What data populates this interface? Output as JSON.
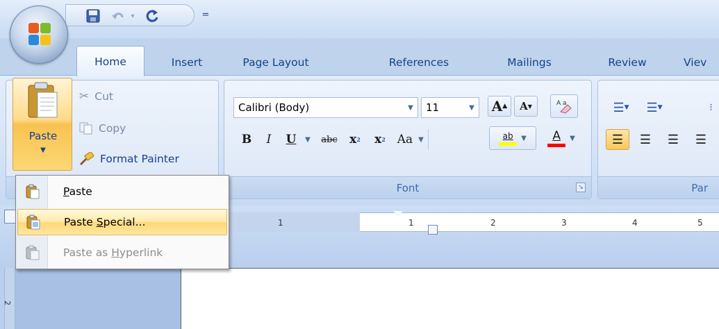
{
  "quick_access": {
    "save_icon": "save-icon",
    "undo_icon": "undo-icon",
    "redo_icon": "redo-icon",
    "customize_glyph": "="
  },
  "tabs": [
    {
      "label": "Home",
      "active": true
    },
    {
      "label": "Insert"
    },
    {
      "label": "Page Layout"
    },
    {
      "label": "References"
    },
    {
      "label": "Mailings"
    },
    {
      "label": "Review"
    },
    {
      "label": "Viev"
    }
  ],
  "clipboard": {
    "paste_label": "Paste",
    "cut_label": "Cut",
    "copy_label": "Copy",
    "format_painter_label": "Format Painter"
  },
  "font_group": {
    "label": "Font",
    "font_name": "Calibri (Body)",
    "font_size": "11",
    "grow_label": "A",
    "shrink_label": "A",
    "bold": "B",
    "italic": "I",
    "underline": "U",
    "strikethrough": "abc",
    "subscript": "x",
    "superscript": "x",
    "change_case": "Aa",
    "highlight": "ab",
    "font_color": "A",
    "colors": {
      "highlight": "#ffff00",
      "font_color": "#ff0000"
    }
  },
  "paragraph_group": {
    "label": "Par"
  },
  "ruler": {
    "ticks": [
      "1",
      "1",
      "2",
      "3",
      "4",
      "5"
    ]
  },
  "vertical_ruler": {
    "tick": "2"
  },
  "paste_menu": {
    "items": [
      {
        "label_pre": "",
        "accel": "P",
        "label_post": "aste",
        "state": "normal"
      },
      {
        "label_pre": "Paste ",
        "accel": "S",
        "label_post": "pecial...",
        "state": "highlighted"
      },
      {
        "label_pre": "Paste as ",
        "accel": "H",
        "label_post": "yperlink",
        "state": "disabled"
      }
    ]
  }
}
